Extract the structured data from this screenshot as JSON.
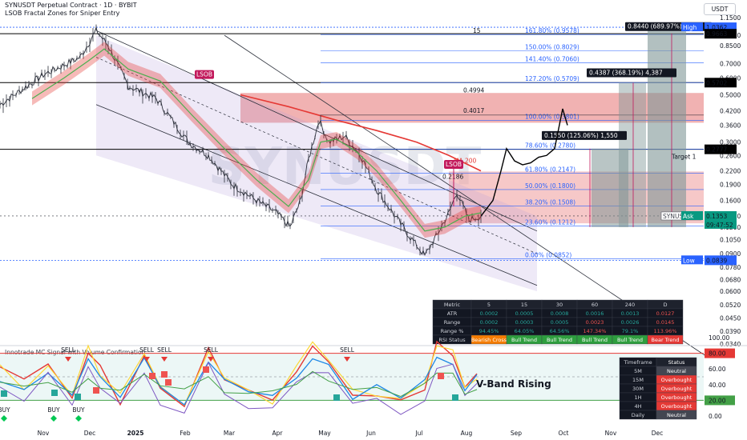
{
  "header": {
    "title": "SYNUSDT Perpetual Contract · 1D · BYBIT",
    "indicator": "LSOB Fractal Zones for Sniper Entry",
    "currency_button": "USDT",
    "watermark": "SYNUSDT"
  },
  "price_axis": {
    "labels": [
      "1.1500",
      "0.9500",
      "0.8500",
      "0.7000",
      "0.6000",
      "0.5000",
      "0.4200",
      "0.3600",
      "0.3000",
      "0.2600",
      "0.2200",
      "0.1900",
      "0.1600",
      "0.1350",
      "0.1200",
      "0.1050",
      "0.0900",
      "0.0780",
      "0.0680",
      "0.0600",
      "0.0520",
      "0.0450",
      "0.0390",
      "0.0340"
    ],
    "marks": [
      {
        "text": "High",
        "value": "1.0362",
        "color": "#2962ff"
      },
      {
        "text": "",
        "value": "0.9663",
        "color": "#000000"
      },
      {
        "text": "",
        "value": "0.5702",
        "color": "#000000"
      },
      {
        "text": "",
        "value": "0.2777",
        "color": "#000000"
      },
      {
        "text": "SYNUSDT",
        "value": "",
        "color": "#434651"
      },
      {
        "text": "Ask",
        "value": "0.1353",
        "color": "#089981",
        "sub": "09:47:52"
      },
      {
        "text": "Low",
        "value": "0.0839",
        "color": "#2962ff"
      }
    ],
    "target_label": "Target 1"
  },
  "time_axis": [
    "Nov",
    "Dec",
    "2025",
    "Feb",
    "Mar",
    "Apr",
    "May",
    "Jun",
    "Jul",
    "Aug",
    "Sep",
    "Oct",
    "Nov",
    "Dec"
  ],
  "fib_levels": [
    {
      "label": "161.80% (0.9578)",
      "value": 0.9578
    },
    {
      "label": "150.00% (0.8029)",
      "value": 0.8029
    },
    {
      "label": "141.40% (0.7060)",
      "value": 0.706
    },
    {
      "label": "127.20% (0.5709)",
      "value": 0.5709
    },
    {
      "label": "100.00% (0.3801)",
      "value": 0.3801
    },
    {
      "label": "78.60% (0.2780)",
      "value": 0.278
    },
    {
      "label": "61.80% (0.2147)",
      "value": 0.2147
    },
    {
      "label": "50.00% (0.1800)",
      "value": 0.18
    },
    {
      "label": "38.20% (0.1508)",
      "value": 0.1508
    },
    {
      "label": "23.60% (0.1212)",
      "value": 0.1212
    },
    {
      "label": "0.00% (0.0852)",
      "value": 0.0852
    }
  ],
  "annotations": {
    "lsob_1": "LSOB",
    "lsob_2": "LSOB",
    "ma_label": "MA 200",
    "level_15": "15",
    "level_04994": "0.4994",
    "level_04017": "0.4017",
    "level_02186": "0.2186",
    "measure_1": "0.8440 (689.97%) 8,",
    "measure_2": "0.4387 (368.19%) 4,387",
    "measure_3": "0.1550 (125.06%) 1,550"
  },
  "metrics_table": {
    "headers": [
      "Metric",
      "5",
      "15",
      "30",
      "60",
      "240",
      "D"
    ],
    "rows": [
      {
        "name": "ATR",
        "cells": [
          "0.0002",
          "0.0005",
          "0.0008",
          "0.0016",
          "0.0013",
          "0.0127"
        ],
        "colors": [
          "#26a69a",
          "#26a69a",
          "#26a69a",
          "#26a69a",
          "#26a69a",
          "#ef5350"
        ]
      },
      {
        "name": "Range",
        "cells": [
          "0.0002",
          "0.0003",
          "0.0005",
          "0.0023",
          "0.0026",
          "0.0145"
        ],
        "colors": [
          "#26a69a",
          "#26a69a",
          "#26a69a",
          "#ef5350",
          "#26a69a",
          "#ef5350"
        ]
      },
      {
        "name": "Range %",
        "cells": [
          "94.45%",
          "64.05%",
          "64.56%",
          "147.34%",
          "79.1%",
          "113.96%"
        ],
        "colors": [
          "#26a69a",
          "#26a69a",
          "#26a69a",
          "#ef5350",
          "#26a69a",
          "#ef5350"
        ]
      }
    ],
    "status_row": {
      "name": "RSI Status",
      "cells": [
        "Bearish Cross",
        "Bull Trend",
        "Bull Trend",
        "Bull Trend",
        "Bull Trend",
        "Bear Trend"
      ],
      "colors": [
        "#f57c00",
        "#2e9e3e",
        "#2e9e3e",
        "#2e9e3e",
        "#2e9e3e",
        "#e53935"
      ]
    }
  },
  "oscillator": {
    "title": "Innotrade MC Signal with Volume Confirmation",
    "band_label": "V-Band Rising",
    "axis_labels": [
      "100.00",
      "80.00",
      "60.00",
      "40.00",
      "20.00",
      "0.00"
    ],
    "signals": [
      "SELL",
      "SELL",
      "SELL",
      "SELL",
      "SELL",
      "BUY",
      "BUY",
      "BUY"
    ],
    "status_table": {
      "headers": [
        "Timeframe",
        "Status"
      ],
      "rows": [
        {
          "tf": "5M",
          "status": "Neutral",
          "color": "#434651"
        },
        {
          "tf": "15M",
          "status": "Overbought",
          "color": "#e53935"
        },
        {
          "tf": "30M",
          "status": "Overbought",
          "color": "#e53935"
        },
        {
          "tf": "1H",
          "status": "Overbought",
          "color": "#e53935"
        },
        {
          "tf": "4H",
          "status": "Overbought",
          "color": "#e53935"
        },
        {
          "tf": "Daily",
          "status": "Neutral",
          "color": "#434651"
        }
      ]
    }
  },
  "chart_data": {
    "type": "line",
    "title": "SYNUSDT Perpetual Contract · 1D · BYBIT",
    "x": [
      "Nov",
      "Dec",
      "2025",
      "Feb",
      "Mar",
      "Apr",
      "May",
      "Jun",
      "Jul",
      "Aug"
    ],
    "series": [
      {
        "name": "",
        "values": [
          0.45,
          0.98,
          0.46,
          0.35,
          0.19,
          0.13,
          0.33,
          0.19,
          0.085,
          0.135
        ]
      },
      {
        "name": "MA 200",
        "values": [
          null,
          null,
          null,
          null,
          0.5,
          0.42,
          0.36,
          0.3,
          0.26,
          0.21
        ]
      }
    ],
    "projection": {
      "x": [
        "Aug",
        "Sep",
        "Oct"
      ],
      "values": [
        0.135,
        0.28,
        0.43
      ]
    },
    "ylim": [
      0.034,
      1.15
    ],
    "scale": "log",
    "legend": "top-left",
    "grid": false,
    "colors": {
      "price": "#2a2e39",
      "ma": "#e53935",
      "zone": "#e57373",
      "fib": "#2962ff",
      "measure": "#8fa0a0"
    }
  }
}
